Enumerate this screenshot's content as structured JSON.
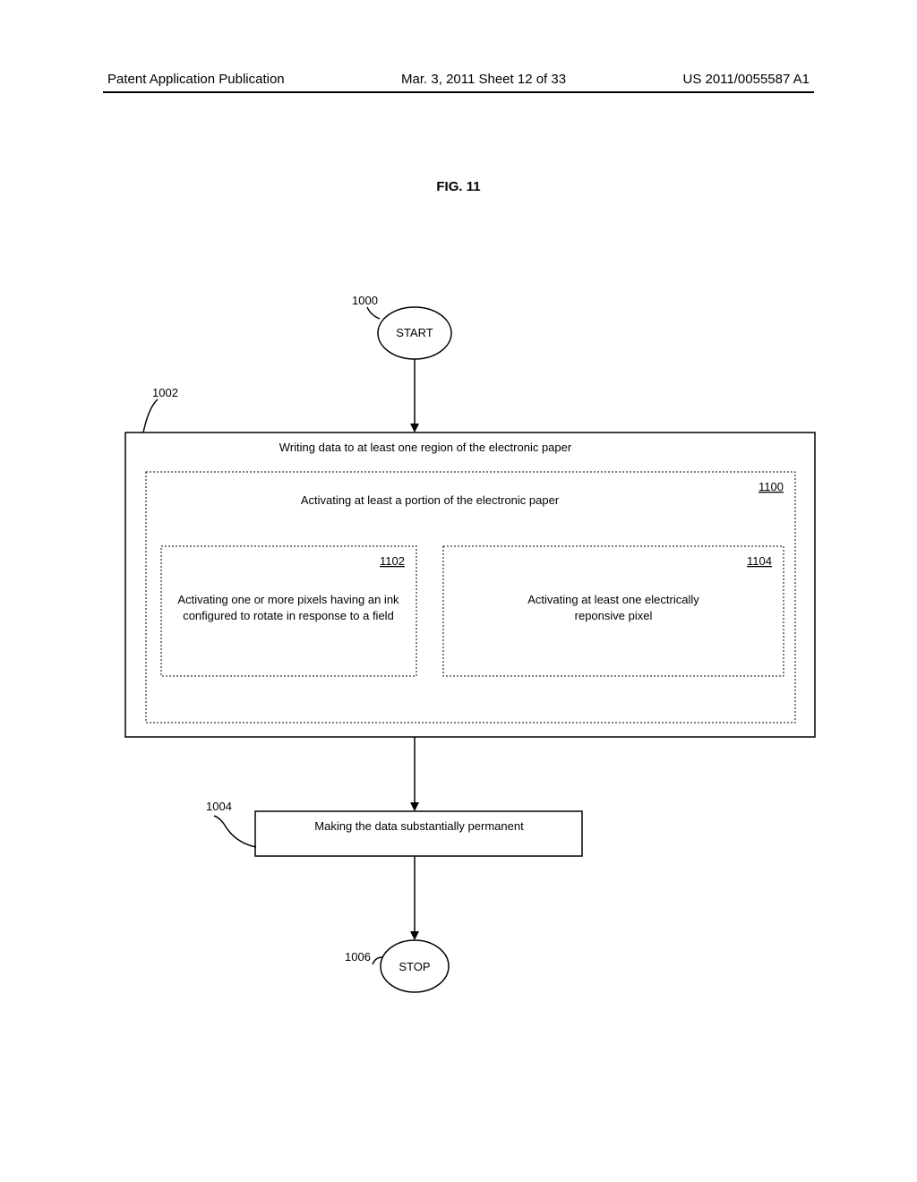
{
  "header": {
    "left": "Patent Application Publication",
    "center": "Mar. 3, 2011  Sheet 12 of 33",
    "right": "US 2011/0055587 A1"
  },
  "figure_title": "FIG. 11",
  "labels": {
    "start": "START",
    "stop": "STOP",
    "ref_1000": "1000",
    "ref_1002": "1002",
    "ref_1004": "1004",
    "ref_1006": "1006",
    "ref_1100": "1100",
    "ref_1102": "1102",
    "ref_1104": "1104",
    "box_1002_text": "Writing data to at least one region of the electronic paper",
    "box_1100_text": "Activating at least a portion of the electronic paper",
    "box_1102_line1": "Activating one or more pixels having an ink",
    "box_1102_line2": "configured to rotate in response to a field",
    "box_1104_line1": "Activating at least one electrically",
    "box_1104_line2": "reponsive pixel",
    "box_1004_text": "Making the data substantially permanent"
  }
}
